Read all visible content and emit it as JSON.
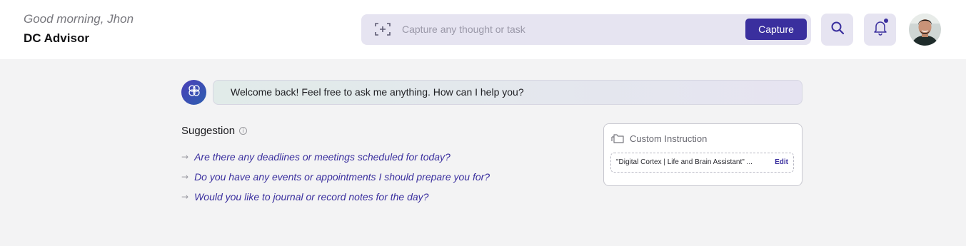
{
  "header": {
    "greeting": "Good morning, Jhon",
    "title": "DC Advisor"
  },
  "capture": {
    "placeholder": "Capture any thought or task",
    "button_label": "Capture",
    "icon": "capture-frame-icon"
  },
  "actions": {
    "search_icon": "search-icon",
    "notification_icon": "bell-icon",
    "has_notification": true
  },
  "user": {
    "avatar_icon": "avatar"
  },
  "chat": {
    "assistant_icon": "brain-icon",
    "welcome_message": "Welcome back! Feel free to ask me anything. How can I help you?"
  },
  "suggestions": {
    "heading": "Suggestion",
    "items": [
      "Are there any deadlines or meetings scheduled for today?",
      "Do you have any events or appointments I should prepare you for?",
      "Would you like to journal or record notes for the day?"
    ]
  },
  "custom_instruction": {
    "title": "Custom Instruction",
    "value": "\"Digital Cortex | Life and Brain Assistant\" ...",
    "edit_label": "Edit"
  },
  "colors": {
    "accent": "#3a2f9e",
    "background": "#f3f3f4",
    "header_background": "#ffffff",
    "control_background": "#e6e4f1"
  }
}
